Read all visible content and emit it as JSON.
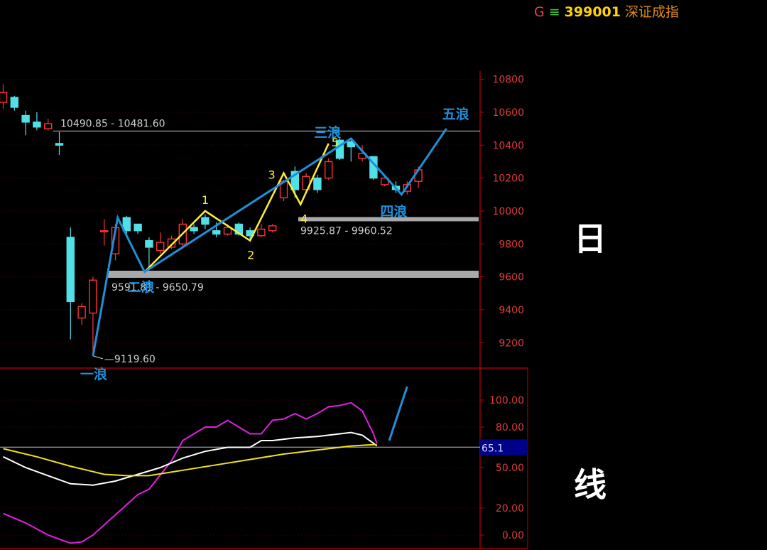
{
  "header": {
    "flag": "G",
    "marker": "≡",
    "code": "399001",
    "name": "深证成指"
  },
  "side_labels": {
    "top": "日",
    "bottom": "线"
  },
  "colors": {
    "up": "#ff3333",
    "down": "#52e0e8",
    "wave": "#1e8fd8",
    "subwave": "#ffee33",
    "kdj_k": "#ffffff",
    "kdj_d": "#f2e21c",
    "kdj_j": "#e020e0",
    "axis": "#c00000",
    "price_label": "#e03a3a"
  },
  "chart_data": [
    {
      "type": "candlestick",
      "title": "",
      "y_ticks": [
        "10800",
        "10600",
        "10400",
        "10200",
        "10000",
        "9800",
        "9600",
        "9400",
        "9200"
      ],
      "ylim": [
        9050,
        10850
      ],
      "candles": [
        {
          "o": 10660,
          "c": 10720,
          "h": 10770,
          "l": 10620
        },
        {
          "o": 10690,
          "c": 10630,
          "h": 10700,
          "l": 10610
        },
        {
          "o": 10580,
          "c": 10540,
          "h": 10610,
          "l": 10460
        },
        {
          "o": 10540,
          "c": 10510,
          "h": 10600,
          "l": 10490
        },
        {
          "o": 10500,
          "c": 10530,
          "h": 10560,
          "l": 10490
        },
        {
          "o": 10410,
          "c": 10400,
          "h": 10480,
          "l": 10340
        },
        {
          "o": 9840,
          "c": 9450,
          "h": 9900,
          "l": 9220
        },
        {
          "o": 9350,
          "c": 9420,
          "h": 9440,
          "l": 9310
        },
        {
          "o": 9380,
          "c": 9580,
          "h": 9600,
          "l": 9119.6
        },
        {
          "o": 9880,
          "c": 9880,
          "h": 9950,
          "l": 9790
        },
        {
          "o": 9740,
          "c": 9900,
          "h": 9920,
          "l": 9700
        },
        {
          "o": 9960,
          "c": 9880,
          "h": 9970,
          "l": 9860
        },
        {
          "o": 9920,
          "c": 9880,
          "h": 9920,
          "l": 9860
        },
        {
          "o": 9820,
          "c": 9780,
          "h": 9840,
          "l": 9640
        },
        {
          "o": 9760,
          "c": 9810,
          "h": 9870,
          "l": 9740
        },
        {
          "o": 9780,
          "c": 9830,
          "h": 9850,
          "l": 9770
        },
        {
          "o": 9800,
          "c": 9920,
          "h": 9950,
          "l": 9770
        },
        {
          "o": 9900,
          "c": 9880,
          "h": 9920,
          "l": 9860
        },
        {
          "o": 9960,
          "c": 9920,
          "h": 9980,
          "l": 9890
        },
        {
          "o": 9880,
          "c": 9860,
          "h": 9930,
          "l": 9840
        },
        {
          "o": 9860,
          "c": 9900,
          "h": 9920,
          "l": 9850
        },
        {
          "o": 9920,
          "c": 9860,
          "h": 9930,
          "l": 9850
        },
        {
          "o": 9880,
          "c": 9850,
          "h": 9900,
          "l": 9820
        },
        {
          "o": 9850,
          "c": 9890,
          "h": 9920,
          "l": 9840
        },
        {
          "o": 9880,
          "c": 9910,
          "h": 9920,
          "l": 9870
        },
        {
          "o": 10080,
          "c": 10180,
          "h": 10190,
          "l": 10060
        },
        {
          "o": 10240,
          "c": 10130,
          "h": 10270,
          "l": 10080
        },
        {
          "o": 10130,
          "c": 10210,
          "h": 10230,
          "l": 10110
        },
        {
          "o": 10200,
          "c": 10130,
          "h": 10220,
          "l": 10110
        },
        {
          "o": 10200,
          "c": 10300,
          "h": 10320,
          "l": 10190
        },
        {
          "o": 10430,
          "c": 10320,
          "h": 10450,
          "l": 10310
        },
        {
          "o": 10420,
          "c": 10390,
          "h": 10430,
          "l": 10300
        },
        {
          "o": 10320,
          "c": 10350,
          "h": 10400,
          "l": 10300
        },
        {
          "o": 10330,
          "c": 10200,
          "h": 10330,
          "l": 10190
        },
        {
          "o": 10160,
          "c": 10200,
          "h": 10220,
          "l": 10150
        },
        {
          "o": 10150,
          "c": 10130,
          "h": 10180,
          "l": 10110
        },
        {
          "o": 10120,
          "c": 10160,
          "h": 10180,
          "l": 10100
        },
        {
          "o": 10180,
          "c": 10250,
          "h": 10270,
          "l": 10140
        }
      ],
      "levels": [
        {
          "y": 10486,
          "style": "line",
          "label": "10490.85 - 10481.60"
        },
        {
          "y": 9946,
          "style": "band",
          "label": "9925.87 - 9960.52"
        },
        {
          "y": 9620,
          "style": "band",
          "label": "9591.81 - 9650.79"
        },
        {
          "y": 9119.6,
          "style": "point",
          "label": "9119.60"
        }
      ],
      "waves": [
        {
          "label": "一浪",
          "i": 8,
          "y": 9119.6
        },
        {
          "i": 10.2,
          "y": 9960
        },
        {
          "label": "二浪",
          "i": 12.6,
          "y": 9630
        },
        {
          "label": "三浪",
          "i": 31,
          "y": 10440
        },
        {
          "label": "四浪",
          "i": 35.5,
          "y": 10100
        },
        {
          "label": "五浪",
          "i": 39.5,
          "y": 10500
        }
      ],
      "subwaves": [
        {
          "i": 12.6,
          "y": 9630
        },
        {
          "label": "1",
          "i": 18,
          "y": 10000
        },
        {
          "label": "2",
          "i": 22,
          "y": 9820
        },
        {
          "label": "3",
          "i": 25,
          "y": 10230
        },
        {
          "label": "4",
          "i": 26.5,
          "y": 10040
        },
        {
          "label": "5",
          "i": 29,
          "y": 10410
        }
      ]
    },
    {
      "type": "line",
      "title": "",
      "y_ticks": [
        "100.00",
        "80.00",
        "50.00",
        "20.00",
        "0.00"
      ],
      "ylim": [
        -5,
        115
      ],
      "current_label": "65.1",
      "current_value": 65.1,
      "x_end_index": 33.3,
      "series": [
        {
          "key": "kdj_j",
          "x": [
            0,
            2,
            4,
            6,
            7,
            8,
            10,
            12,
            13,
            15,
            16,
            17,
            18,
            19,
            20,
            21,
            22,
            23,
            24,
            25,
            26,
            27,
            28,
            29,
            30,
            31,
            32,
            33,
            33.3
          ],
          "values": [
            16,
            9,
            0,
            -6,
            -5,
            0,
            15,
            30,
            34,
            55,
            70,
            75,
            80,
            80,
            85,
            80,
            75,
            75,
            85,
            86,
            90,
            86,
            90,
            95,
            96,
            98,
            92,
            75,
            68
          ]
        },
        {
          "key": "kdj_k",
          "x": [
            0,
            2,
            4,
            6,
            8,
            10,
            12,
            14,
            16,
            18,
            20,
            22,
            23,
            24,
            26,
            28,
            30,
            31,
            32,
            33,
            33.3
          ],
          "values": [
            58,
            50,
            44,
            38,
            37,
            40,
            45,
            50,
            57,
            62,
            65,
            65,
            70,
            70,
            72,
            73,
            75,
            76,
            74,
            68,
            66
          ]
        },
        {
          "key": "kdj_d",
          "x": [
            0,
            3,
            6,
            9,
            11,
            13,
            16,
            19,
            22,
            25,
            28,
            31,
            33,
            33.3
          ],
          "values": [
            64,
            58,
            51,
            45,
            44,
            44,
            48,
            52,
            56,
            60,
            63,
            66,
            67,
            67
          ]
        },
        {
          "key": "wave",
          "x": [
            34.4,
            36
          ],
          "values": [
            70,
            110
          ]
        }
      ]
    }
  ]
}
